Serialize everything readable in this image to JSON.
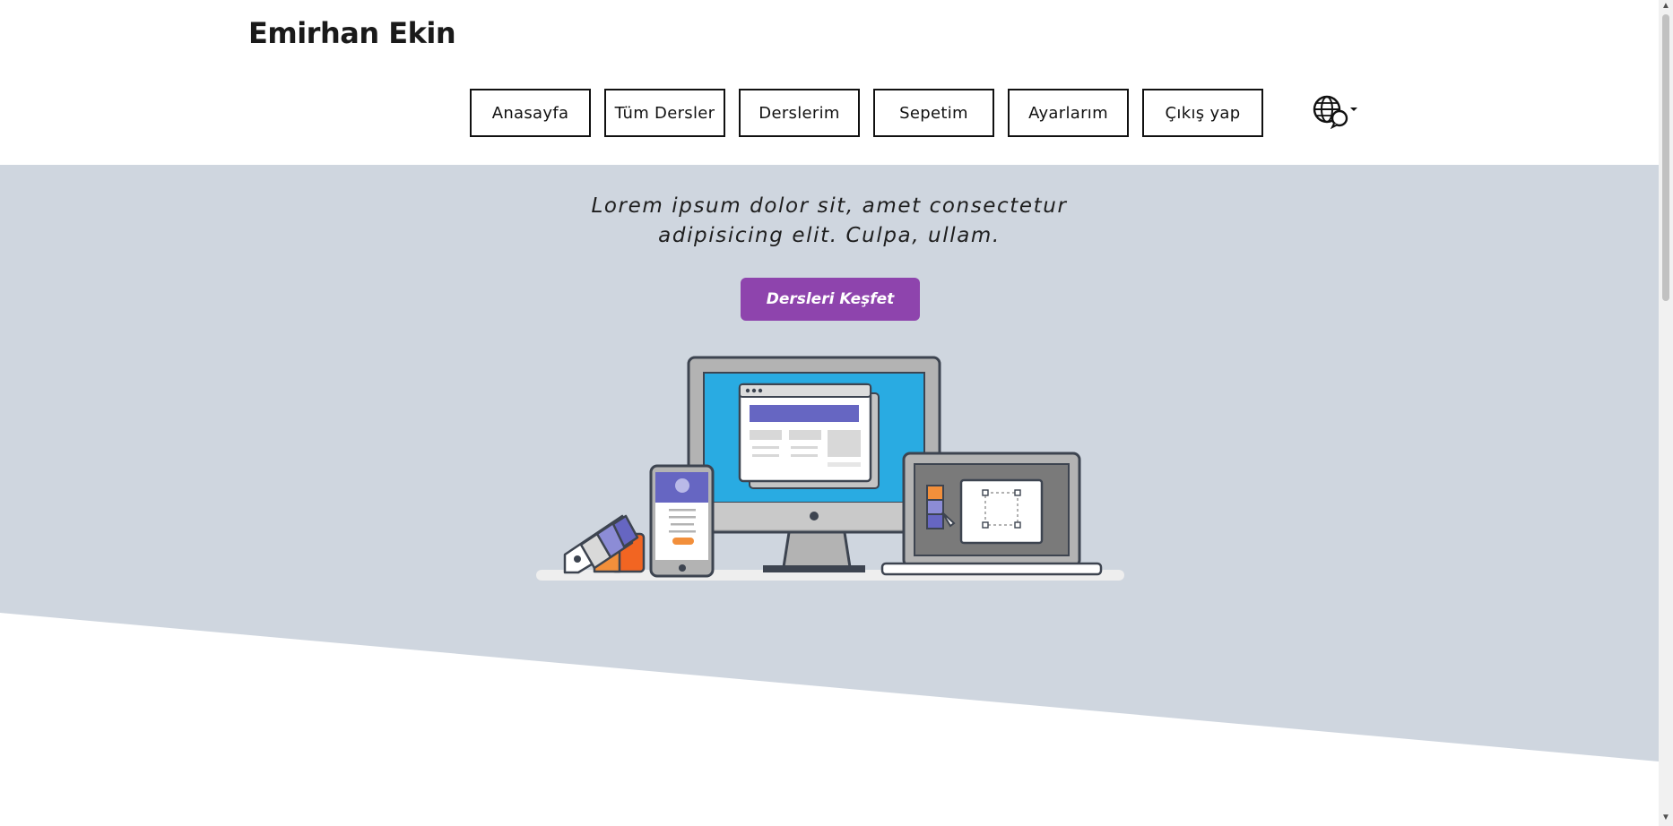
{
  "header": {
    "brand": "Emirhan Ekin",
    "nav": [
      "Anasayfa",
      "Tüm Dersler",
      "Derslerim",
      "Sepetim",
      "Ayarlarım",
      "Çıkış yap"
    ],
    "language_icon": "globe-chat-icon"
  },
  "hero": {
    "tagline_line1": "Lorem ipsum dolor sit, amet consectetur",
    "tagline_line2": "adipisicing elit. Culpa, ullam.",
    "cta_label": "Dersleri Keşfet",
    "colors": {
      "background": "#cfd6df",
      "cta": "#8e44ad",
      "screen": "#29abe2"
    }
  }
}
